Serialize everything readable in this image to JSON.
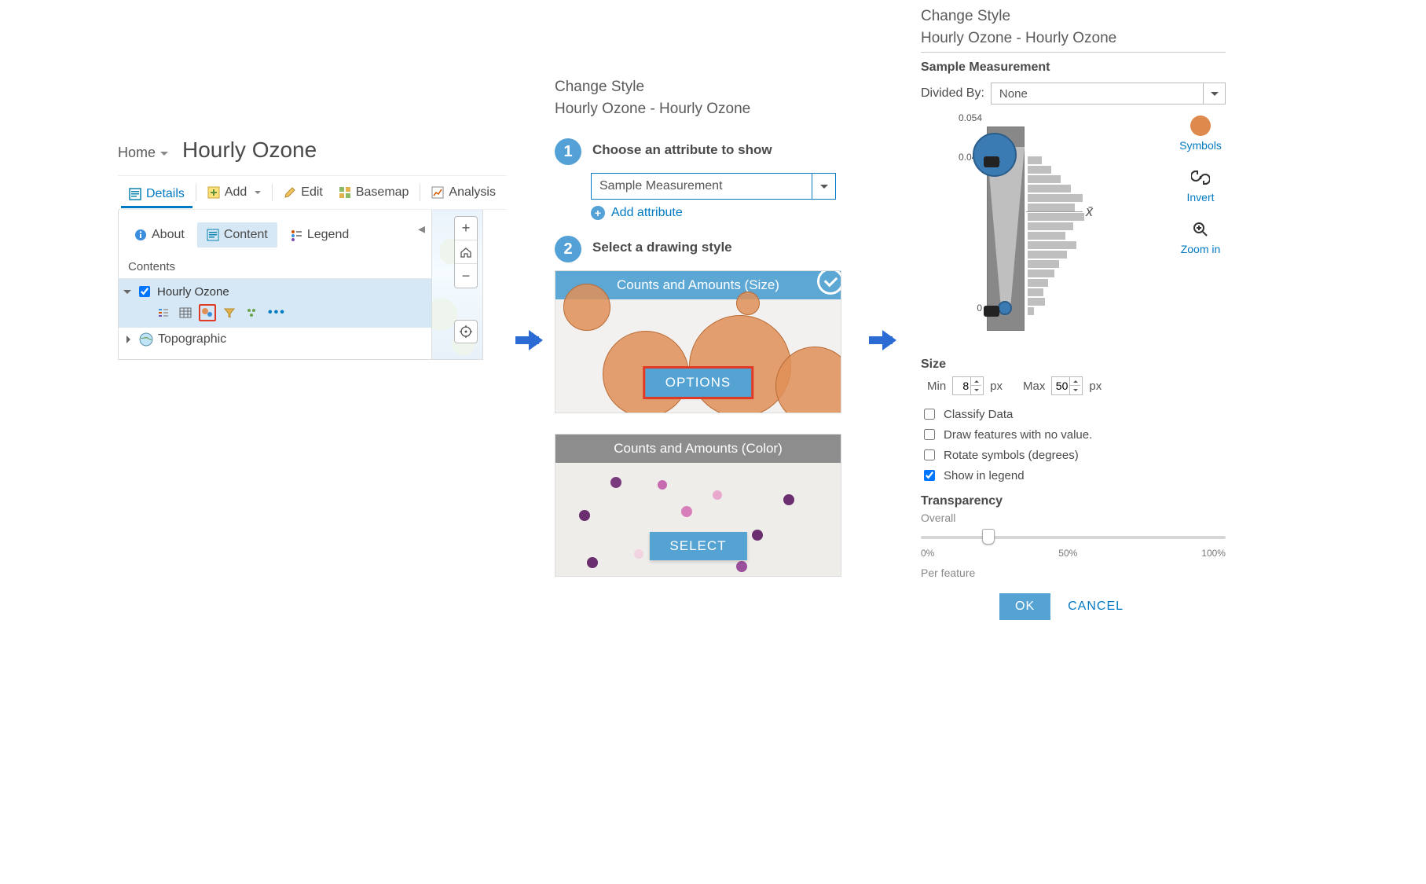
{
  "left": {
    "home": "Home",
    "title": "Hourly Ozone",
    "toolbar": {
      "details": "Details",
      "add": "Add",
      "edit": "Edit",
      "basemap": "Basemap",
      "analysis": "Analysis"
    },
    "tabs": {
      "about": "About",
      "content": "Content",
      "legend": "Legend"
    },
    "contents_heading": "Contents",
    "layer_name": "Hourly Ozone",
    "basemap_name": "Topographic"
  },
  "mid": {
    "title": "Change Style",
    "subtitle": "Hourly Ozone - Hourly Ozone",
    "step1_label": "Choose an attribute to show",
    "attr_value": "Sample Measurement",
    "add_attribute": "Add attribute",
    "step2_label": "Select a drawing style",
    "card_size_title": "Counts and Amounts (Size)",
    "card_size_btn": "OPTIONS",
    "card_color_title": "Counts and Amounts (Color)",
    "card_color_btn": "SELECT"
  },
  "right": {
    "title": "Change Style",
    "subtitle": "Hourly Ozone - Hourly Ozone",
    "field": "Sample Measurement",
    "divided_by_label": "Divided By:",
    "divided_by_value": "None",
    "scale_top": "0.054",
    "scale_upper": "0.045",
    "scale_lower": "0",
    "tools": {
      "symbols": "Symbols",
      "invert": "Invert",
      "zoom": "Zoom in"
    },
    "size_heading": "Size",
    "min_label": "Min",
    "min_value": "8",
    "px": "px",
    "max_label": "Max",
    "max_value": "50",
    "checks": {
      "classify": "Classify Data",
      "novalue": "Draw features with no value.",
      "rotate": "Rotate symbols (degrees)",
      "legend": "Show in legend"
    },
    "transparency_heading": "Transparency",
    "overall": "Overall",
    "ticks": {
      "t0": "0%",
      "t50": "50%",
      "t100": "100%"
    },
    "per_feature": "Per feature",
    "ok": "OK",
    "cancel": "CANCEL"
  }
}
